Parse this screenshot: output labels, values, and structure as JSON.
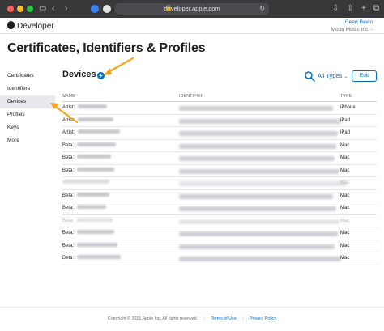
{
  "browser": {
    "url": "developer.apple.com",
    "colors": {
      "close": "#ff5f57",
      "minimize": "#febc2e",
      "zoom": "#28c840"
    }
  },
  "nav": {
    "brand": "Developer",
    "user_name": "Geert Bevin",
    "team_name": "Moog Music Inc. - "
  },
  "page_title": "Certificates, Identifiers & Profiles",
  "sidebar": {
    "items": [
      {
        "label": "Certificates"
      },
      {
        "label": "Identifiers"
      },
      {
        "label": "Devices"
      },
      {
        "label": "Profiles"
      },
      {
        "label": "Keys"
      },
      {
        "label": "More"
      }
    ]
  },
  "main": {
    "title": "Devices",
    "add_label": "+",
    "filter_label": "All Types",
    "edit_label": "Edit",
    "columns": {
      "name": "NAME",
      "identifier": "IDENTIFIER",
      "type": "TYPE"
    },
    "rows": [
      {
        "name": "Artist:",
        "type": "iPhone"
      },
      {
        "name": "Artist:",
        "type": "iPad"
      },
      {
        "name": "Artist:",
        "type": "iPad"
      },
      {
        "name": "Beta:",
        "type": "Mac"
      },
      {
        "name": "Beta:",
        "type": "Mac"
      },
      {
        "name": "Beta:",
        "type": "Mac"
      },
      {
        "name": "",
        "type": "Mac"
      },
      {
        "name": "Beta:",
        "type": "Mac"
      },
      {
        "name": "Beta:",
        "type": "Mac"
      },
      {
        "name": "Beta:",
        "type": "Mac"
      },
      {
        "name": "Beta:",
        "type": "Mac"
      },
      {
        "name": "Beta:",
        "type": "Mac"
      },
      {
        "name": "Beta:",
        "type": "Mac"
      }
    ]
  },
  "footer": {
    "copyright": "Copyright © 2021 Apple Inc. All rights reserved.",
    "terms": "Terms of Use",
    "privacy": "Privacy Policy"
  },
  "accent_color": "#0070c9",
  "annotation_color": "#f5a623"
}
